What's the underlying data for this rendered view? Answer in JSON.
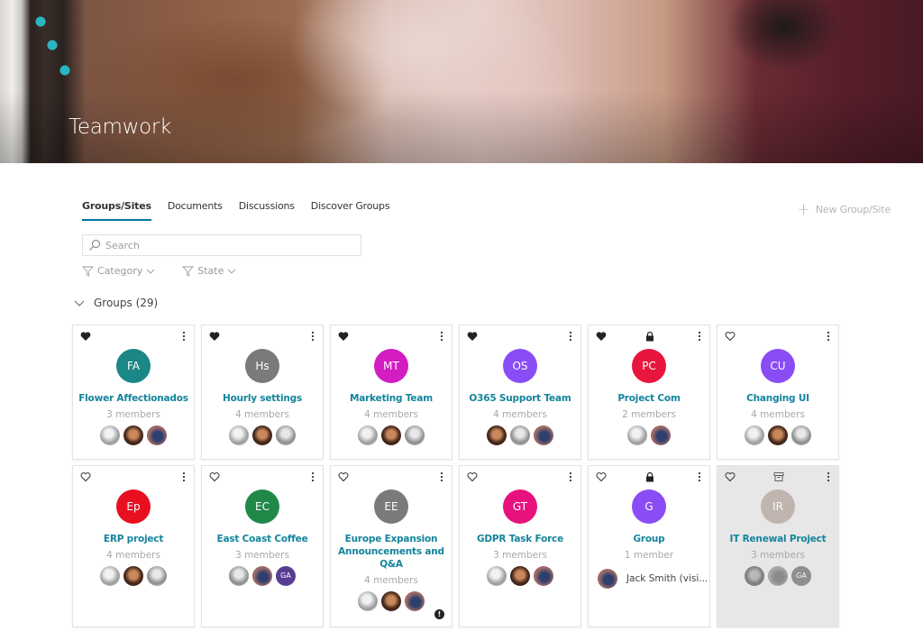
{
  "header": {
    "title": "Teamwork"
  },
  "tabs": [
    {
      "label": "Groups/Sites",
      "active": true
    },
    {
      "label": "Documents",
      "active": false
    },
    {
      "label": "Discussions",
      "active": false
    },
    {
      "label": "Discover Groups",
      "active": false
    }
  ],
  "toolbar": {
    "new_group_label": "New Group/Site"
  },
  "search": {
    "placeholder": "Search",
    "value": ""
  },
  "filters": [
    {
      "label": "Category"
    },
    {
      "label": "State"
    }
  ],
  "groups_section": {
    "label": "Groups (29)"
  },
  "colors": {
    "accent": "#0078a0",
    "group_name": "#14849c"
  },
  "groups": [
    {
      "initials": "FA",
      "name": "Flower Affectionados",
      "members": "3 members",
      "color": "#1b8786",
      "favorite": true,
      "state": "",
      "people": [
        "gray",
        "dark",
        "mixed"
      ]
    },
    {
      "initials": "Hs",
      "name": "Hourly settings",
      "members": "4 members",
      "color": "#7a7a7a",
      "favorite": true,
      "state": "",
      "people": [
        "gray",
        "dark",
        "light"
      ]
    },
    {
      "initials": "MT",
      "name": "Marketing Team",
      "members": "4 members",
      "color": "#d41cc3",
      "favorite": true,
      "state": "",
      "people": [
        "gray",
        "dark",
        "light"
      ]
    },
    {
      "initials": "OS",
      "name": "O365 Support Team",
      "members": "4 members",
      "color": "#8a4cf5",
      "favorite": true,
      "state": "",
      "people": [
        "dark",
        "light",
        "mixed"
      ]
    },
    {
      "initials": "PC",
      "name": "Project Com",
      "members": "2 members",
      "color": "#e8163f",
      "favorite": true,
      "state": "private",
      "people": [
        "gray",
        "mixed"
      ]
    },
    {
      "initials": "CU",
      "name": "Changing UI",
      "members": "4 members",
      "color": "#8a4cf5",
      "favorite": false,
      "state": "",
      "people": [
        "gray",
        "dark",
        "light"
      ]
    },
    {
      "initials": "Ep",
      "name": "ERP project",
      "members": "4 members",
      "color": "#e80f21",
      "favorite": false,
      "state": "",
      "people": [
        "gray",
        "dark",
        "light"
      ]
    },
    {
      "initials": "EC",
      "name": "East Coast Coffee",
      "members": "3 members",
      "color": "#21884a",
      "favorite": false,
      "state": "",
      "people": [
        "light",
        "mixed",
        "ga"
      ]
    },
    {
      "initials": "EE",
      "name": "Europe Expansion Announcements and Q&A",
      "members": "4 members",
      "color": "#7a7a7a",
      "favorite": false,
      "state": "",
      "people": [
        "gray",
        "dark",
        "mixed"
      ],
      "alert": true
    },
    {
      "initials": "GT",
      "name": "GDPR Task Force",
      "members": "3 members",
      "color": "#e7127e",
      "favorite": false,
      "state": "",
      "people": [
        "gray",
        "dark",
        "mixed"
      ]
    },
    {
      "initials": "G",
      "name": "Group",
      "members": "1 member",
      "color": "#8a4cf5",
      "favorite": false,
      "state": "private",
      "single_person": "Jack Smith (visi..."
    },
    {
      "initials": "IR",
      "name": "IT Renewal Project",
      "members": "3 members",
      "color": "#b3a39c",
      "favorite": false,
      "state": "archived",
      "people": [
        "dark",
        "mixed",
        "ga"
      ]
    }
  ],
  "person_labels": {
    "ga": "GA"
  },
  "alert_label": "!"
}
